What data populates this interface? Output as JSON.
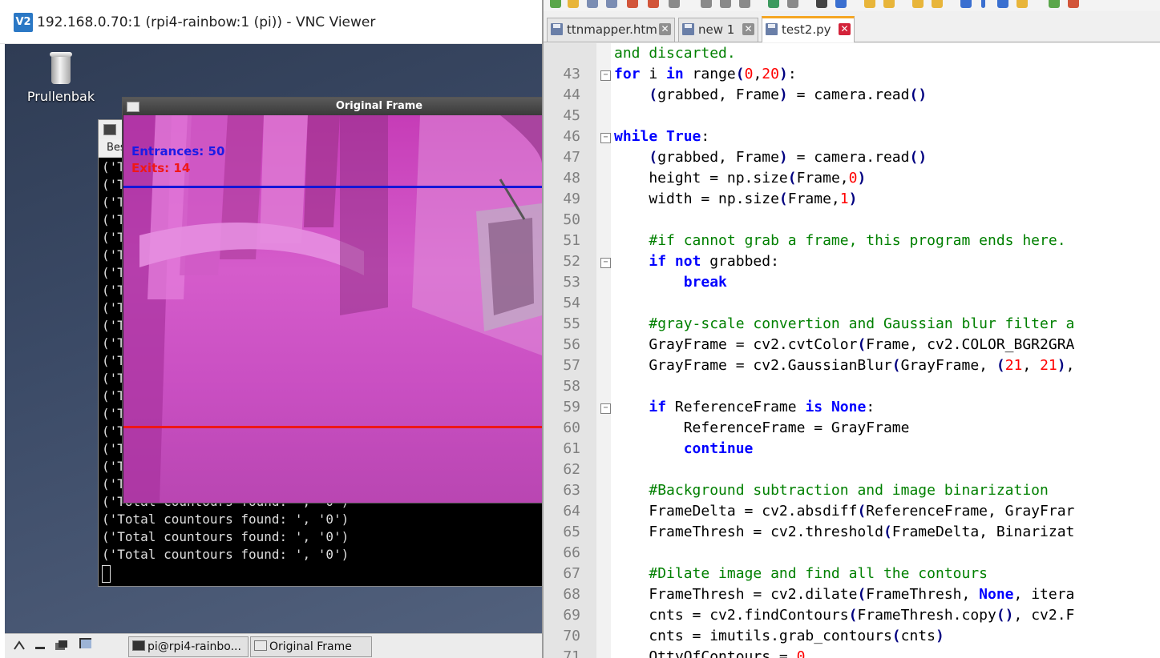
{
  "vnc": {
    "logo": "V2",
    "title": "192.168.0.70:1 (rpi4-rainbow:1 (pi)) - VNC Viewer"
  },
  "desktop": {
    "trash_label": "Prullenbak"
  },
  "terminal": {
    "menu_partial": "Bes",
    "partial_line": "('T",
    "lines": [
      "('Total countours found: ', '0')",
      "('Total countours found: ', '0')",
      "('Total countours found: ', '0')",
      "('Total countours found: ', '0')"
    ]
  },
  "original_frame": {
    "title": "Original Frame",
    "entrances_label": "Entrances: 50",
    "exits_label": "Exits: 14"
  },
  "taskbar": {
    "items": [
      {
        "label": "pi@rpi4-rainbo..."
      },
      {
        "label": "Original Frame"
      }
    ]
  },
  "notepad": {
    "tabs": [
      {
        "label": "ttnmapper.htm",
        "active": false
      },
      {
        "label": "new 1",
        "active": false
      },
      {
        "label": "test2.py",
        "active": true
      }
    ],
    "code": [
      {
        "ln": "",
        "fold": "",
        "html": "<span class='cm'>and discarted.</span>"
      },
      {
        "ln": "43",
        "fold": "-",
        "html": "<span class='kw'>for</span> i <span class='kw'>in</span> range<span class='op'>(</span><span class='nm'>0</span>,<span class='nm'>20</span><span class='op'>)</span>:"
      },
      {
        "ln": "44",
        "fold": "",
        "html": "    <span class='op'>(</span>grabbed, Frame<span class='op'>)</span> = camera.read<span class='op'>()</span>"
      },
      {
        "ln": "45",
        "fold": "",
        "html": ""
      },
      {
        "ln": "46",
        "fold": "-",
        "html": "<span class='kw'>while</span> <span class='kw'>True</span>:"
      },
      {
        "ln": "47",
        "fold": "",
        "html": "    <span class='op'>(</span>grabbed, Frame<span class='op'>)</span> = camera.read<span class='op'>()</span>"
      },
      {
        "ln": "48",
        "fold": "",
        "html": "    height = np.size<span class='op'>(</span>Frame,<span class='nm'>0</span><span class='op'>)</span>"
      },
      {
        "ln": "49",
        "fold": "",
        "html": "    width = np.size<span class='op'>(</span>Frame,<span class='nm'>1</span><span class='op'>)</span>"
      },
      {
        "ln": "50",
        "fold": "",
        "html": ""
      },
      {
        "ln": "51",
        "fold": "",
        "html": "    <span class='cm'>#if cannot grab a frame, this program ends here.</span>"
      },
      {
        "ln": "52",
        "fold": "-",
        "html": "    <span class='kw'>if</span> <span class='kw'>not</span> grabbed:"
      },
      {
        "ln": "53",
        "fold": "",
        "html": "        <span class='kw'>break</span>"
      },
      {
        "ln": "54",
        "fold": "",
        "html": ""
      },
      {
        "ln": "55",
        "fold": "",
        "html": "    <span class='cm'>#gray-scale convertion and Gaussian blur filter a</span>"
      },
      {
        "ln": "56",
        "fold": "",
        "html": "    GrayFrame = cv2.cvtColor<span class='op'>(</span>Frame, cv2.COLOR_BGR2GRA"
      },
      {
        "ln": "57",
        "fold": "",
        "html": "    GrayFrame = cv2.GaussianBlur<span class='op'>(</span>GrayFrame, <span class='op'>(</span><span class='nm'>21</span>, <span class='nm'>21</span><span class='op'>)</span>,"
      },
      {
        "ln": "58",
        "fold": "",
        "html": ""
      },
      {
        "ln": "59",
        "fold": "-",
        "html": "    <span class='kw'>if</span> ReferenceFrame <span class='kw'>is</span> <span class='kw'>None</span>:"
      },
      {
        "ln": "60",
        "fold": "",
        "html": "        ReferenceFrame = GrayFrame"
      },
      {
        "ln": "61",
        "fold": "",
        "html": "        <span class='kw'>continue</span>"
      },
      {
        "ln": "62",
        "fold": "",
        "html": ""
      },
      {
        "ln": "63",
        "fold": "",
        "html": "    <span class='cm'>#Background subtraction and image binarization</span>"
      },
      {
        "ln": "64",
        "fold": "",
        "html": "    FrameDelta = cv2.absdiff<span class='op'>(</span>ReferenceFrame, GrayFrar"
      },
      {
        "ln": "65",
        "fold": "",
        "html": "    FrameThresh = cv2.threshold<span class='op'>(</span>FrameDelta, Binarizat"
      },
      {
        "ln": "66",
        "fold": "",
        "html": ""
      },
      {
        "ln": "67",
        "fold": "",
        "html": "    <span class='cm'>#Dilate image and find all the contours</span>"
      },
      {
        "ln": "68",
        "fold": "",
        "html": "    FrameThresh = cv2.dilate<span class='op'>(</span>FrameThresh, <span class='kw'>None</span>, itera"
      },
      {
        "ln": "69",
        "fold": "",
        "html": "    cnts = cv2.findContours<span class='op'>(</span>FrameThresh.copy<span class='op'>()</span>, cv2.F"
      },
      {
        "ln": "70",
        "fold": "",
        "html": "    cnts = imutils.grab_contours<span class='op'>(</span>cnts<span class='op'>)</span>"
      },
      {
        "ln": "71",
        "fold": "",
        "html": "    QttyOfContours = <span class='nm'>0</span>"
      }
    ]
  }
}
